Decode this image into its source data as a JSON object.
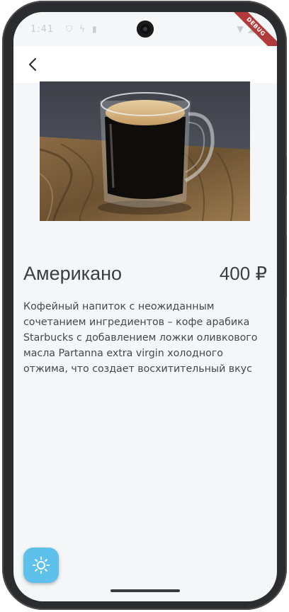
{
  "status_bar": {
    "time": "1:41",
    "left_icons": [
      "shield-icon",
      "notification-icon",
      "sd-card-icon"
    ],
    "right_icons": [
      "wifi-icon",
      "signal-icon",
      "battery-icon"
    ],
    "debug_label": "DEBUG"
  },
  "app_bar": {
    "back_icon": "chevron-left-icon"
  },
  "product": {
    "image_alt": "coffee-cup-photo",
    "title": "Американо",
    "price": "400 ₽",
    "description": "Кофейный напиток с неожиданным сочетанием ингредиентов – кофе арабика Starbucks с добавлением ложки оливкового масла Partanna extra virgin холодного отжима, что создает восхитительный вкус"
  },
  "fab": {
    "icon": "sun-icon",
    "color": "#5ec1ec"
  },
  "colors": {
    "background": "#f4f6f7",
    "app_bar": "#ffffff",
    "text": "#3b3d40",
    "debug_banner": "#b23a3a"
  }
}
